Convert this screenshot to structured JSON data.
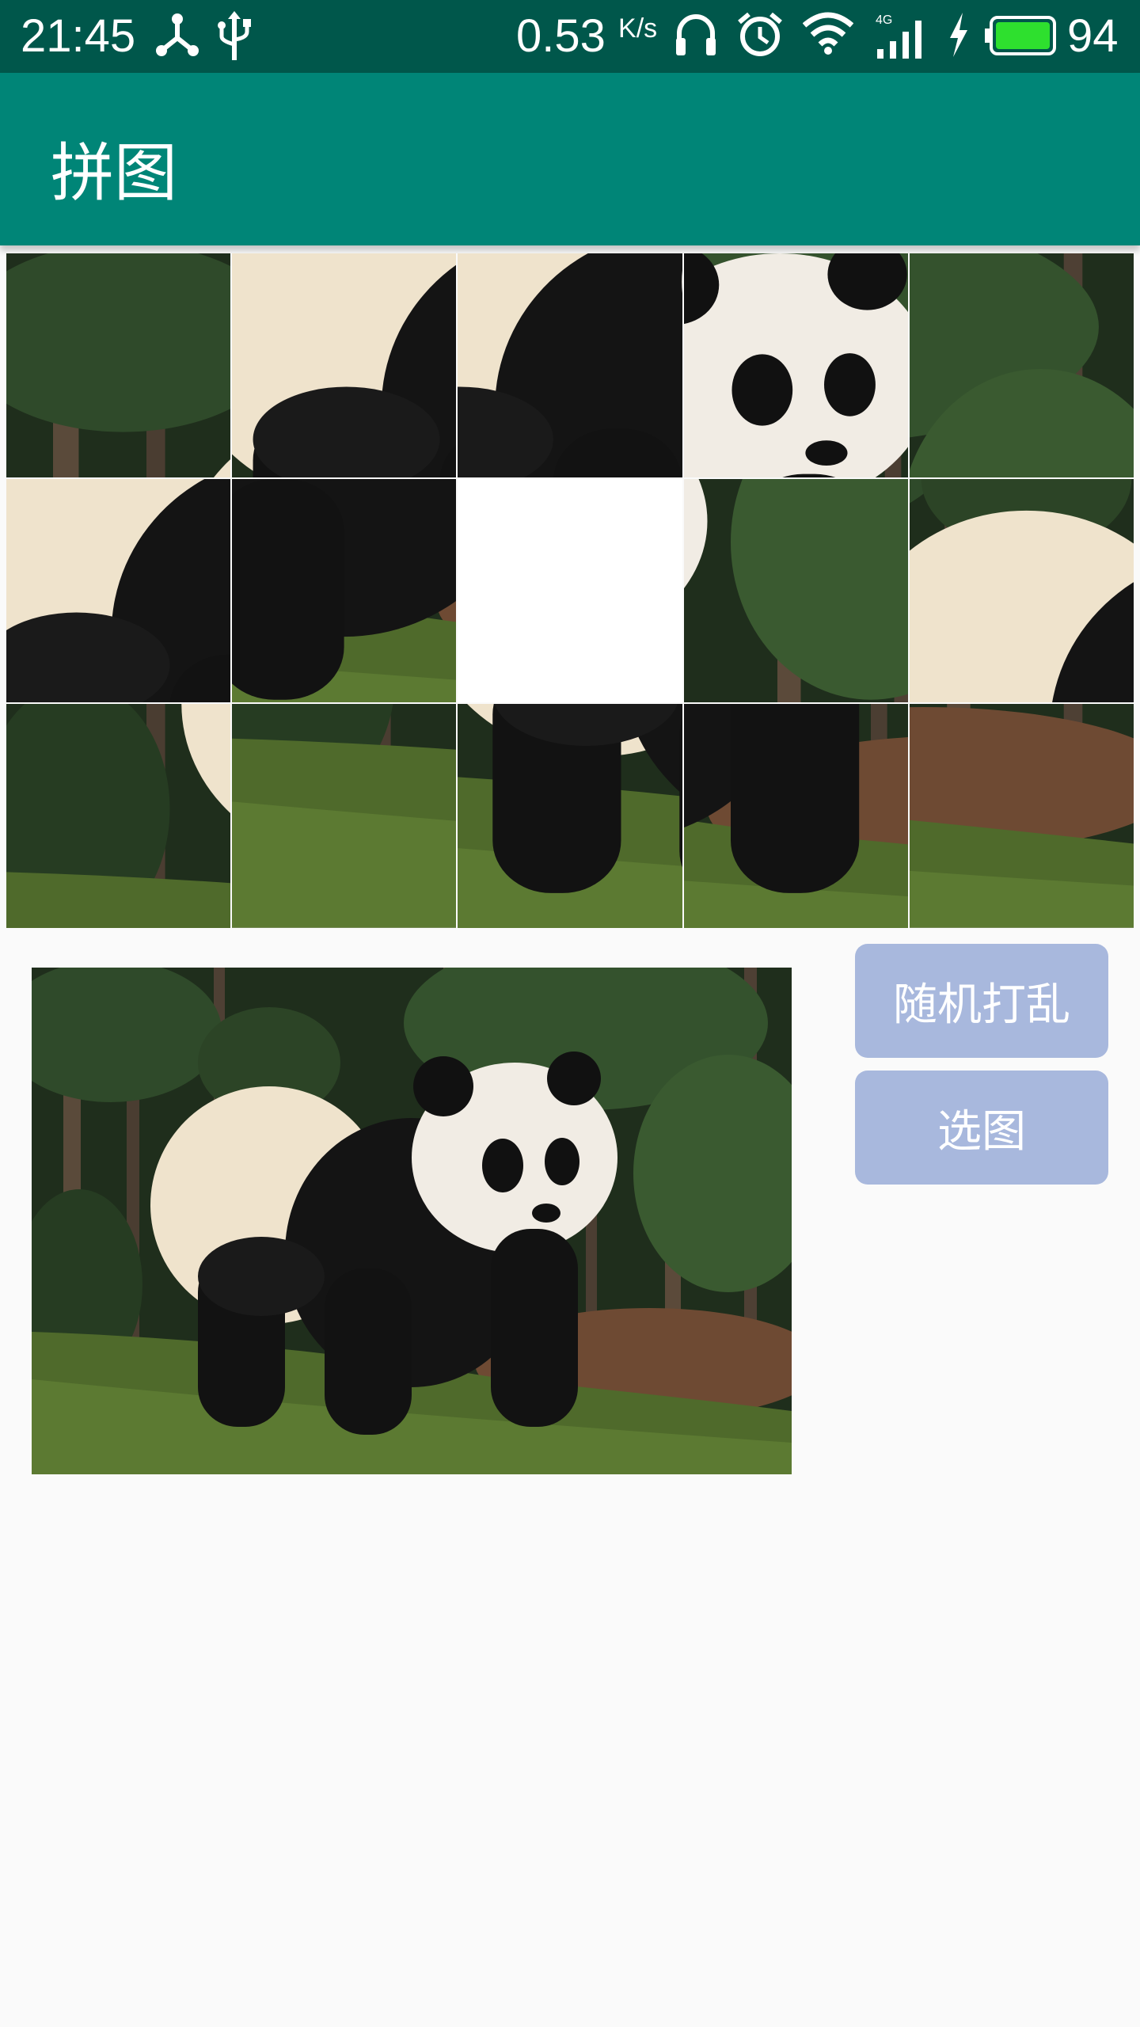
{
  "status_bar": {
    "time": "21:45",
    "net_speed_value": "0.53",
    "net_speed_unit": "K/s",
    "network_type": "4G",
    "battery_level": "94",
    "icons": [
      "share-icon",
      "usb-icon",
      "headphones-icon",
      "alarm-icon",
      "wifi-icon",
      "signal-icon",
      "charging-icon",
      "battery-icon"
    ]
  },
  "app_bar": {
    "title": "拼图"
  },
  "puzzle": {
    "rows": 3,
    "cols": 5,
    "empty_tile": "row 2, col 3"
  },
  "buttons": {
    "shuffle_label": "随机打乱",
    "select_image_label": "选图"
  },
  "colors": {
    "status_bar": "#00574b",
    "app_bar": "#008577",
    "button": "#a8b8dd",
    "background": "#fafafa"
  }
}
